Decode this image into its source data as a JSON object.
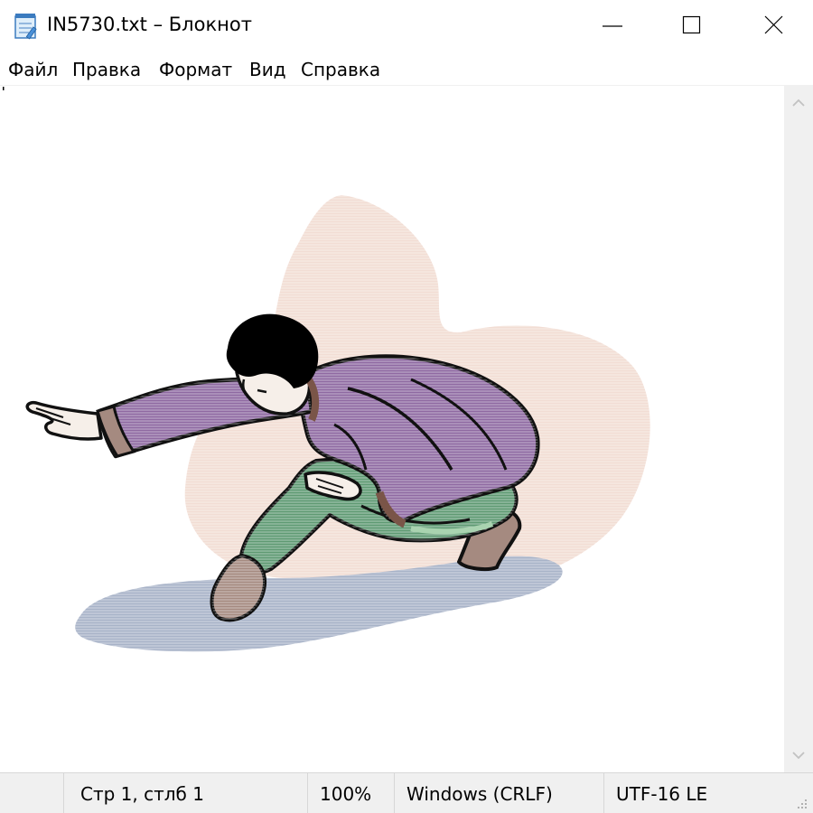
{
  "window": {
    "title": "IN5730.txt – Блокнот",
    "app_icon": "notepad-icon",
    "controls": {
      "minimize_icon": "minimize-icon",
      "maximize_icon": "maximize-icon",
      "close_icon": "close-icon"
    }
  },
  "menu": {
    "items": [
      {
        "label": "Файл"
      },
      {
        "label": "Правка"
      },
      {
        "label": "Формат"
      },
      {
        "label": "Вид"
      },
      {
        "label": "Справка"
      }
    ]
  },
  "editor": {
    "content_description_icon": "clipart-figure-image"
  },
  "scrollbar": {
    "up_icon": "chevron-up-icon",
    "down_icon": "chevron-down-icon"
  },
  "status": {
    "position": "Стр 1, стлб 1",
    "zoom": "100%",
    "line_ending": "Windows (CRLF)",
    "encoding": "UTF-16 LE"
  },
  "colors": {
    "peach": "#f2ddd4",
    "shadow": "#a8b3c8",
    "robe": "#8f6aa2",
    "pants": "#5f9a73",
    "skin": "#f6efe9",
    "boot": "#a58a80"
  }
}
